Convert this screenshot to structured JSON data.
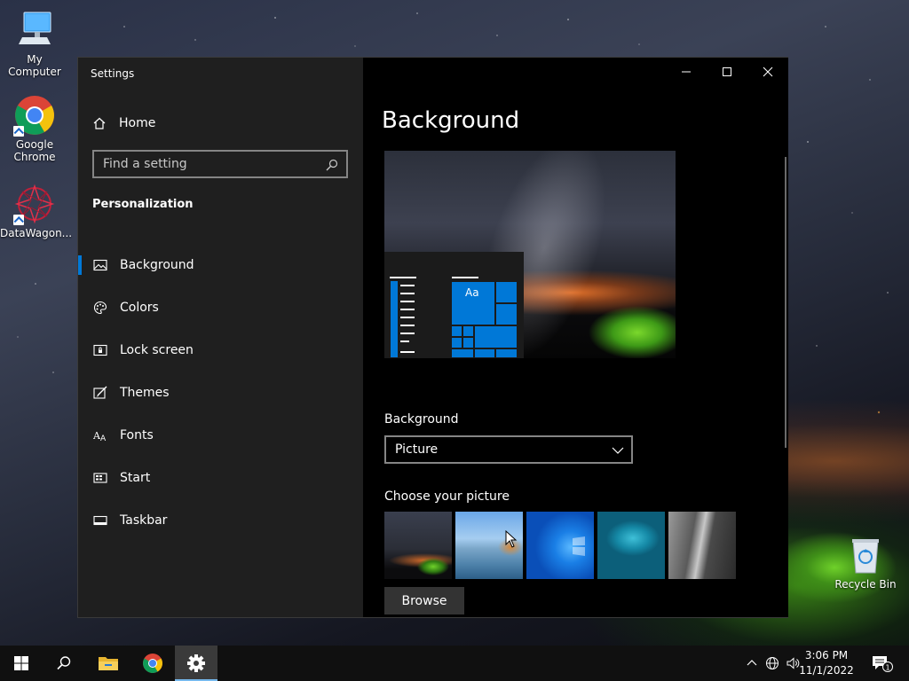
{
  "desktop": {
    "icons": [
      {
        "label": "My Computer"
      },
      {
        "label": "Google Chrome"
      },
      {
        "label": "DataWagon..."
      },
      {
        "label": "Recycle Bin"
      }
    ]
  },
  "window": {
    "title": "Settings",
    "controls": [
      "minimize-icon",
      "maximize-icon",
      "close-icon"
    ]
  },
  "sidebar": {
    "home_label": "Home",
    "search_placeholder": "Find a setting",
    "section_title": "Personalization",
    "items": [
      {
        "label": "Background",
        "icon": "picture-icon",
        "active": true
      },
      {
        "label": "Colors",
        "icon": "palette-icon",
        "active": false
      },
      {
        "label": "Lock screen",
        "icon": "lock-screen-icon",
        "active": false
      },
      {
        "label": "Themes",
        "icon": "themes-icon",
        "active": false
      },
      {
        "label": "Fonts",
        "icon": "fonts-icon",
        "active": false
      },
      {
        "label": "Start",
        "icon": "start-icon",
        "active": false
      },
      {
        "label": "Taskbar",
        "icon": "taskbar-icon",
        "active": false
      }
    ]
  },
  "content": {
    "page_title": "Background",
    "preview_sample_text": "Aa",
    "background_label": "Background",
    "background_value": "Picture",
    "choose_picture_label": "Choose your picture",
    "browse_label": "Browse"
  },
  "taskbar": {
    "time": "3:06 PM",
    "date": "11/1/2022",
    "notification_count": "1",
    "accent": "#0078d7"
  }
}
